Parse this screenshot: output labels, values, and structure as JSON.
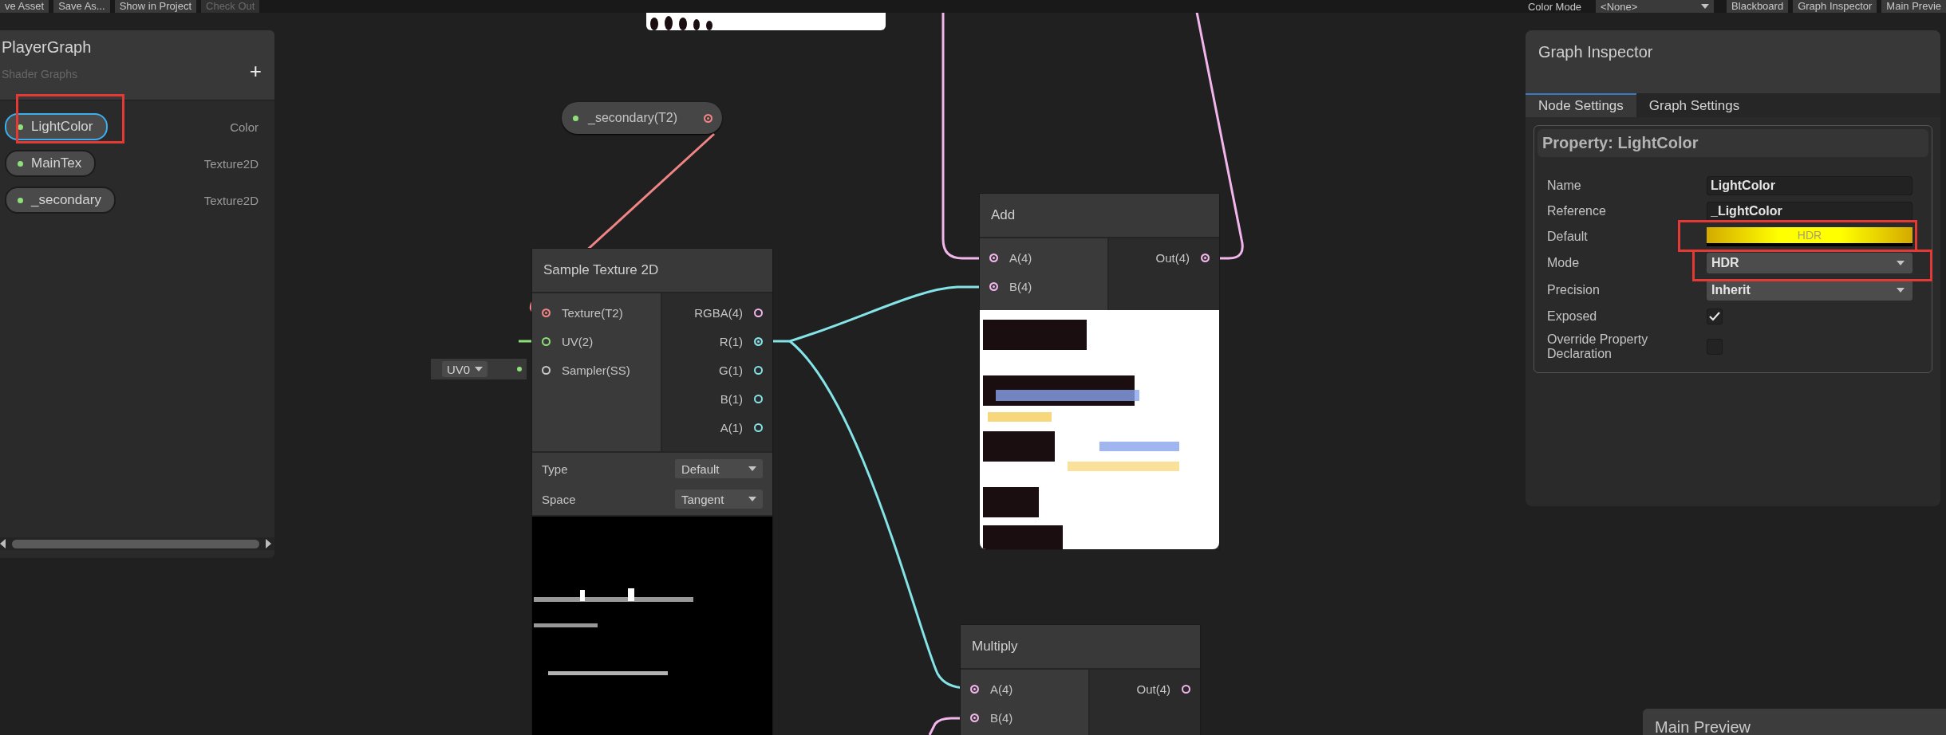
{
  "toolbar": {
    "buttons_left": [
      {
        "label": "ve Asset",
        "disabled": false
      },
      {
        "label": "Save As...",
        "disabled": false
      },
      {
        "label": "Show in Project",
        "disabled": false
      },
      {
        "label": "Check Out",
        "disabled": true
      }
    ],
    "color_mode_label": "Color Mode",
    "color_mode_value": "<None>",
    "buttons_right": [
      "Blackboard",
      "Graph Inspector",
      "Main Previe"
    ]
  },
  "blackboard": {
    "title": "PlayerGraph",
    "subtitle": "Shader Graphs",
    "add_button": "+",
    "properties": [
      {
        "name": "LightColor",
        "type": "Color",
        "selected": true
      },
      {
        "name": "MainTex",
        "type": "Texture2D",
        "selected": false
      },
      {
        "name": "_secondary",
        "type": "Texture2D",
        "selected": false
      }
    ]
  },
  "nodes": [
    {
      "kind": "property",
      "title": "_secondary(T2)",
      "output": {
        "connected": true,
        "color": "#f08585"
      }
    },
    {
      "kind": "node",
      "title": "Sample Texture 2D",
      "inputs": [
        {
          "label": "Texture(T2)",
          "connected": true,
          "color": "#f08585"
        },
        {
          "label": "UV(2)",
          "connected": false,
          "color": "#8ee07a",
          "inline": "UV0"
        },
        {
          "label": "Sampler(SS)",
          "connected": false,
          "color": "#c8c8c8"
        }
      ],
      "outputs": [
        {
          "label": "RGBA(4)",
          "connected": false,
          "color": "#f3b6ec"
        },
        {
          "label": "R(1)",
          "connected": true,
          "color": "#84e4e7"
        },
        {
          "label": "G(1)",
          "connected": false,
          "color": "#84e4e7"
        },
        {
          "label": "B(1)",
          "connected": false,
          "color": "#84e4e7"
        },
        {
          "label": "A(1)",
          "connected": false,
          "color": "#84e4e7"
        }
      ],
      "settings": [
        {
          "label": "Type",
          "value": "Default"
        },
        {
          "label": "Space",
          "value": "Tangent"
        }
      ],
      "preview": {
        "kind": "picture"
      }
    },
    {
      "kind": "node",
      "title": "Add",
      "inputs": [
        {
          "label": "A(4)",
          "connected": true,
          "color": "#f3b6ec"
        },
        {
          "label": "B(4)",
          "connected": true,
          "color": "#f3b6ec"
        }
      ],
      "outputs": [
        {
          "label": "Out(4)",
          "connected": true,
          "color": "#f3b6ec"
        }
      ],
      "preview": {
        "kind": "picture"
      }
    },
    {
      "kind": "node",
      "title": "Multiply",
      "inputs": [
        {
          "label": "A(4)",
          "connected": true,
          "color": "#f3b6ec"
        },
        {
          "label": "B(4)",
          "connected": true,
          "color": "#f3b6ec"
        }
      ],
      "outputs": [
        {
          "label": "Out(4)",
          "connected": false,
          "color": "#f3b6ec"
        }
      ]
    }
  ],
  "graph_inspector": {
    "title": "Graph Inspector",
    "tabs": [
      {
        "label": "Node Settings",
        "selected": true
      },
      {
        "label": "Graph Settings",
        "selected": false
      }
    ],
    "section_title": "Property: LightColor",
    "fields": [
      {
        "kind": "text",
        "label": "Name",
        "value": "LightColor"
      },
      {
        "kind": "text",
        "label": "Reference",
        "value": "_LightColor"
      },
      {
        "kind": "color",
        "label": "Default",
        "value": "HDR",
        "color": "#ffff00"
      },
      {
        "kind": "dropdown",
        "label": "Mode",
        "value": "HDR"
      },
      {
        "kind": "dropdown",
        "label": "Precision",
        "value": "Inherit"
      },
      {
        "kind": "checkbox",
        "label": "Exposed",
        "checked": true
      },
      {
        "kind": "checkbox",
        "label": "Override Property Declaration",
        "checked": false
      }
    ]
  },
  "main_preview": {
    "title": "Main Preview"
  }
}
